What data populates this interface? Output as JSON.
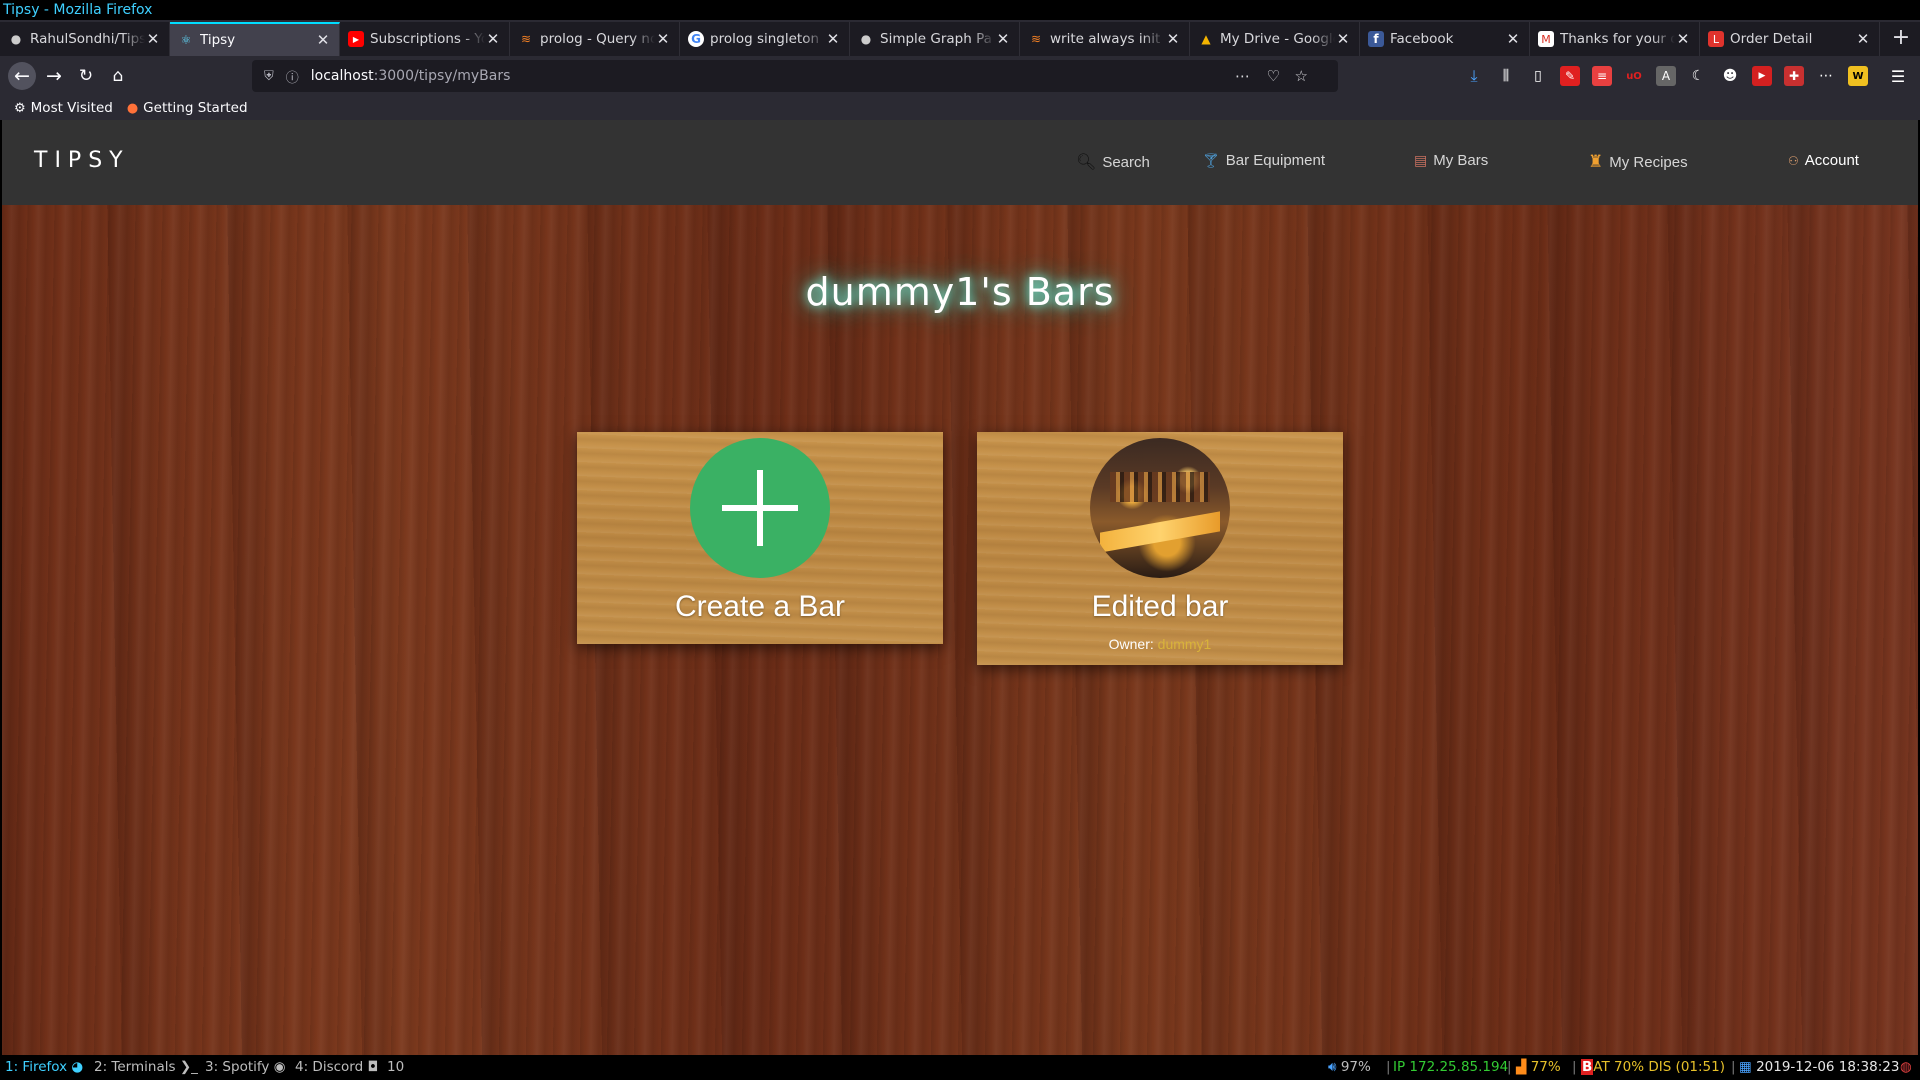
{
  "window_title": "Tipsy - Mozilla Firefox",
  "tabs": [
    {
      "title": "RahulSondhi/Tipsy",
      "icon": "github-icon",
      "active": false
    },
    {
      "title": "Tipsy",
      "icon": "react-icon",
      "active": true
    },
    {
      "title": "Subscriptions - YouTube",
      "icon": "youtube-icon",
      "active": false
    },
    {
      "title": "prolog - Query no",
      "icon": "stackoverflow-icon",
      "active": false
    },
    {
      "title": "prolog singleton",
      "icon": "google-icon",
      "active": false
    },
    {
      "title": "Simple Graph Pa",
      "icon": "github-icon",
      "active": false
    },
    {
      "title": "write always init",
      "icon": "stackoverflow-icon",
      "active": false
    },
    {
      "title": "My Drive - Google",
      "icon": "drive-icon",
      "active": false
    },
    {
      "title": "Facebook",
      "icon": "facebook-icon",
      "active": false
    },
    {
      "title": "Thanks for your o",
      "icon": "gmail-icon",
      "active": false
    },
    {
      "title": "Order Detail",
      "icon": "lending-icon",
      "active": false
    }
  ],
  "url": {
    "host": "localhost",
    "path": ":3000/tipsy/myBars"
  },
  "bookmarks": [
    {
      "label": "Most Visited",
      "icon": "gear-icon"
    },
    {
      "label": "Getting Started",
      "icon": "firefox-icon"
    }
  ],
  "app": {
    "brand": "TIPSY",
    "nav": {
      "search": "Search",
      "equipment": "Bar Equipment",
      "bars": "My Bars",
      "recipes": "My Recipes",
      "account": "Account"
    },
    "heading": "dummy1's Bars",
    "cards": {
      "create": {
        "title": "Create a Bar"
      },
      "bar": {
        "title": "Edited bar",
        "owner_label": "Owner:",
        "owner_name": "dummy1"
      }
    }
  },
  "statusbar": {
    "workspaces": [
      {
        "label": "1: Firefox",
        "focused": true
      },
      {
        "label": "2: Terminals",
        "focused": false
      },
      {
        "label": "3: Spotify",
        "focused": false
      },
      {
        "label": "4: Discord",
        "focused": false
      },
      {
        "label": "10",
        "focused": false
      }
    ],
    "volume": "97%",
    "ip": "IP 172.25.85.194",
    "wifi": "77%",
    "battery": "AT 70% DIS (01:51)",
    "datetime": "2019-12-06 18:38:23"
  },
  "colors": {
    "accent": "#00ddff",
    "create_green": "#3ab164",
    "owner_gold": "#d9b33a",
    "status_cyan": "#3fd0ff"
  }
}
